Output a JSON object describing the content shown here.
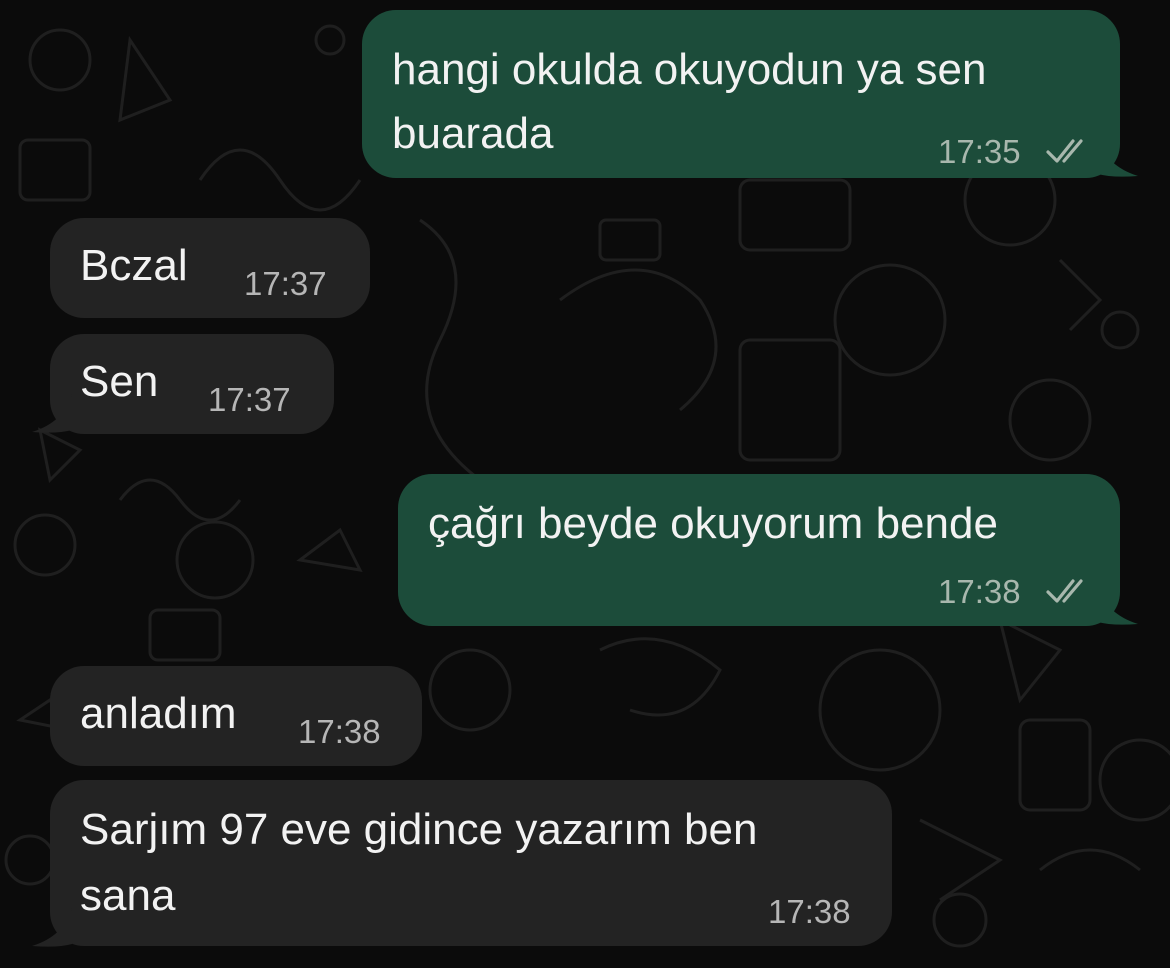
{
  "messages": [
    {
      "direction": "outgoing",
      "lines": [
        "hangi okulda okuyodun ya sen",
        "buarada"
      ],
      "time": "17:35",
      "status": "read-double-check-icon"
    },
    {
      "direction": "incoming",
      "lines": [
        "Bczal"
      ],
      "time": "17:37"
    },
    {
      "direction": "incoming",
      "lines": [
        "Sen"
      ],
      "time": "17:37"
    },
    {
      "direction": "outgoing",
      "lines": [
        "çağrı beyde okuyorum bende"
      ],
      "time": "17:38",
      "status": "read-double-check-icon"
    },
    {
      "direction": "incoming",
      "lines": [
        "anladım"
      ],
      "time": "17:38"
    },
    {
      "direction": "incoming",
      "lines": [
        "Sarjım 97 eve gidince yazarım ben",
        "sana"
      ],
      "time": "17:38"
    }
  ],
  "colors": {
    "background": "#0b0b0b",
    "outgoing_bubble": "#1c4c3a",
    "incoming_bubble": "#232323",
    "text": "#f2f2f2",
    "timestamp": "#b6b6b6"
  }
}
